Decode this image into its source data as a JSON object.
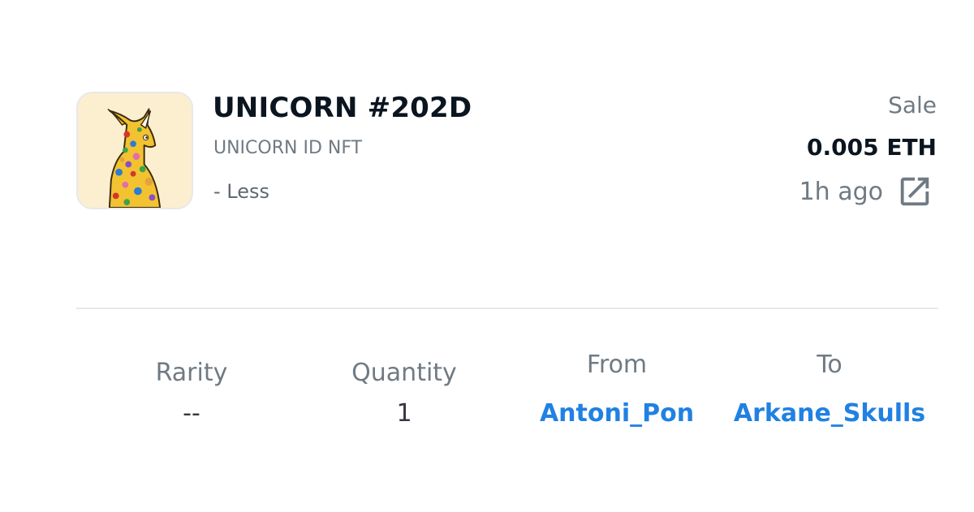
{
  "item": {
    "title": "UNICORN #202D",
    "collection": "UNICORN ID NFT",
    "toggle_label": "- Less",
    "thumbnail_icon": "unicorn-nft-image"
  },
  "event": {
    "type": "Sale",
    "price": "0.005 ETH",
    "time": "1h ago",
    "link_icon": "external-link-icon"
  },
  "details": {
    "rarity": {
      "label": "Rarity",
      "value": "--"
    },
    "quantity": {
      "label": "Quantity",
      "value": "1"
    },
    "from": {
      "label": "From",
      "value": "Antoni_Pon"
    },
    "to": {
      "label": "To",
      "value": "Arkane_Skulls"
    }
  },
  "colors": {
    "link": "#2081e2",
    "heading": "#0b1520",
    "muted": "#707a83",
    "divider": "#e6e8eb",
    "thumbnail_bg": "#fbefcf"
  }
}
